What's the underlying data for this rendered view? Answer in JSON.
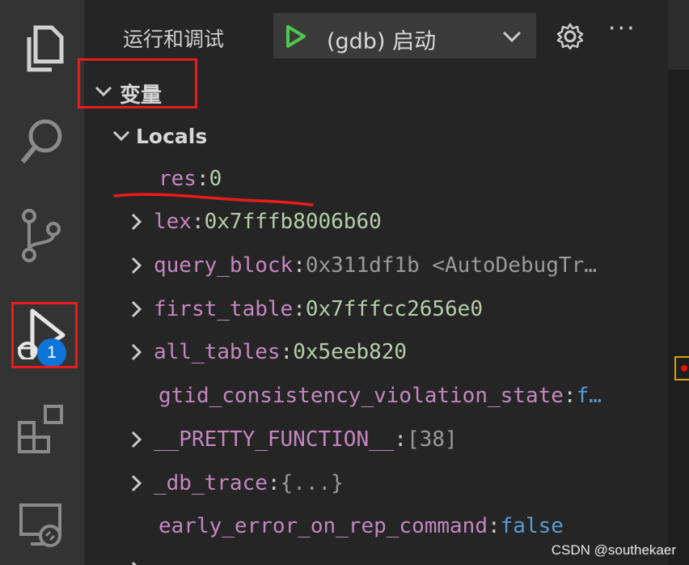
{
  "activity_bar": {
    "items": [
      {
        "icon": "files-icon"
      },
      {
        "icon": "search-icon"
      },
      {
        "icon": "source-control-icon"
      },
      {
        "icon": "run-debug-icon",
        "badge": "1"
      },
      {
        "icon": "extensions-icon"
      },
      {
        "icon": "remote-explorer-icon"
      }
    ]
  },
  "sidebar": {
    "title": "运行和调试",
    "launch_config": "(gdb) 启动",
    "more": "···"
  },
  "variables": {
    "section_title": "变量",
    "scope": "Locals",
    "items": [
      {
        "name": "res",
        "value": "0",
        "expandable": false
      },
      {
        "name": "lex",
        "value": "0x7fffb8006b60",
        "expandable": true
      },
      {
        "name": "query_block",
        "value": "0x311df1b <AutoDebugTr…",
        "expandable": true
      },
      {
        "name": "first_table",
        "value": "0x7fffcc2656e0",
        "expandable": true
      },
      {
        "name": "all_tables",
        "value": "0x5eeb820",
        "expandable": true
      },
      {
        "name": "gtid_consistency_violation_state",
        "value": "f…",
        "expandable": false
      },
      {
        "name": "__PRETTY_FUNCTION__",
        "value": "[38]",
        "expandable": true
      },
      {
        "name": "_db_trace",
        "value": "{...}",
        "expandable": true
      },
      {
        "name": "early_error_on_rep_command",
        "value": "false",
        "expandable": false
      }
    ]
  },
  "watermark": "CSDN @southekaer",
  "colors": {
    "activity_bar": "#333333",
    "sidebar": "#252526",
    "variable_name": "#c586c0",
    "number_value": "#b5cea8",
    "boolean_value": "#569cd6",
    "annotation_red": "#e81c1c",
    "badge": "#0e74d8"
  }
}
